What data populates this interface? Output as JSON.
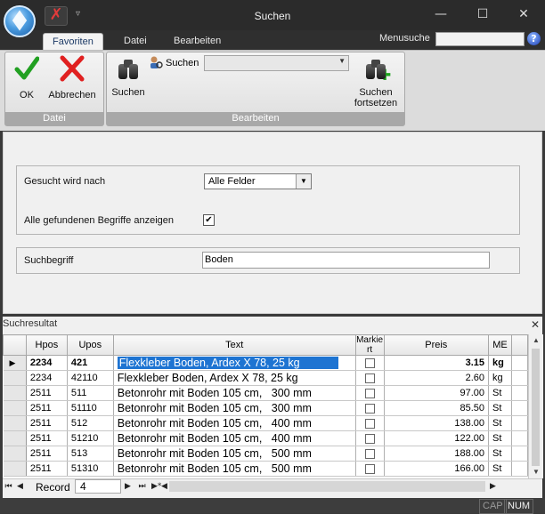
{
  "window": {
    "title": "Suchen",
    "controls": {
      "minimize": "—",
      "maximize": "☐",
      "close": "✕"
    }
  },
  "ribbon_tabs": [
    "Favoriten",
    "Datei",
    "Bearbeiten"
  ],
  "menusuche": {
    "label": "Menusuche",
    "value": ""
  },
  "ribbon": {
    "ok_label": "OK",
    "abbrechen_label": "Abbrechen",
    "datei_group": "Datei",
    "suchen_label": "Suchen",
    "suchen_small_label": "Suchen",
    "search_combo_value": "",
    "suchen_fortsetzen_line1": "Suchen",
    "suchen_fortsetzen_line2": "fortsetzen",
    "bearbeiten_group": "Bearbeiten"
  },
  "form": {
    "gesucht_label": "Gesucht wird nach",
    "gesucht_value": "Alle Felder",
    "alle_label": "Alle gefundenen Begriffe anzeigen",
    "alle_checked": true,
    "suchbegriff_label": "Suchbegriff",
    "suchbegriff_value": "Boden"
  },
  "results": {
    "title": "Suchresultat",
    "close": "✕",
    "columns": {
      "hpos": "Hpos",
      "upos": "Upos",
      "text": "Text",
      "markiert": "Markiert",
      "preis": "Preis",
      "me": "ME"
    },
    "rows": [
      {
        "hpos": "2234",
        "upos": "421",
        "text": "Flexkleber Boden, Ardex X 78, 25 kg",
        "preis": "3.15",
        "me": "kg"
      },
      {
        "hpos": "2234",
        "upos": "42110",
        "text": "Flexkleber Boden, Ardex X 78, 25 kg",
        "preis": "2.60",
        "me": "kg"
      },
      {
        "hpos": "2511",
        "upos": "511",
        "text": "Betonrohr mit Boden 105 cm,   300 mm",
        "preis": "97.00",
        "me": "St"
      },
      {
        "hpos": "2511",
        "upos": "51110",
        "text": "Betonrohr mit Boden 105 cm,   300 mm",
        "preis": "85.50",
        "me": "St"
      },
      {
        "hpos": "2511",
        "upos": "512",
        "text": "Betonrohr mit Boden 105 cm,   400 mm",
        "preis": "138.00",
        "me": "St"
      },
      {
        "hpos": "2511",
        "upos": "51210",
        "text": "Betonrohr mit Boden 105 cm,   400 mm",
        "preis": "122.00",
        "me": "St"
      },
      {
        "hpos": "2511",
        "upos": "513",
        "text": "Betonrohr mit Boden 105 cm,   500 mm",
        "preis": "188.00",
        "me": "St"
      },
      {
        "hpos": "2511",
        "upos": "51310",
        "text": "Betonrohr mit Boden 105 cm,   500 mm",
        "preis": "166.00",
        "me": "St"
      }
    ],
    "current_row": 0,
    "record_label": "Record",
    "record_value": "4"
  },
  "status": {
    "cap": "CAP",
    "num": "NUM"
  },
  "colors": {
    "titlebar": "#2b2b2b",
    "selection": "#1e74d2",
    "ok_check": "#22a022",
    "cancel_x": "#e02020"
  }
}
